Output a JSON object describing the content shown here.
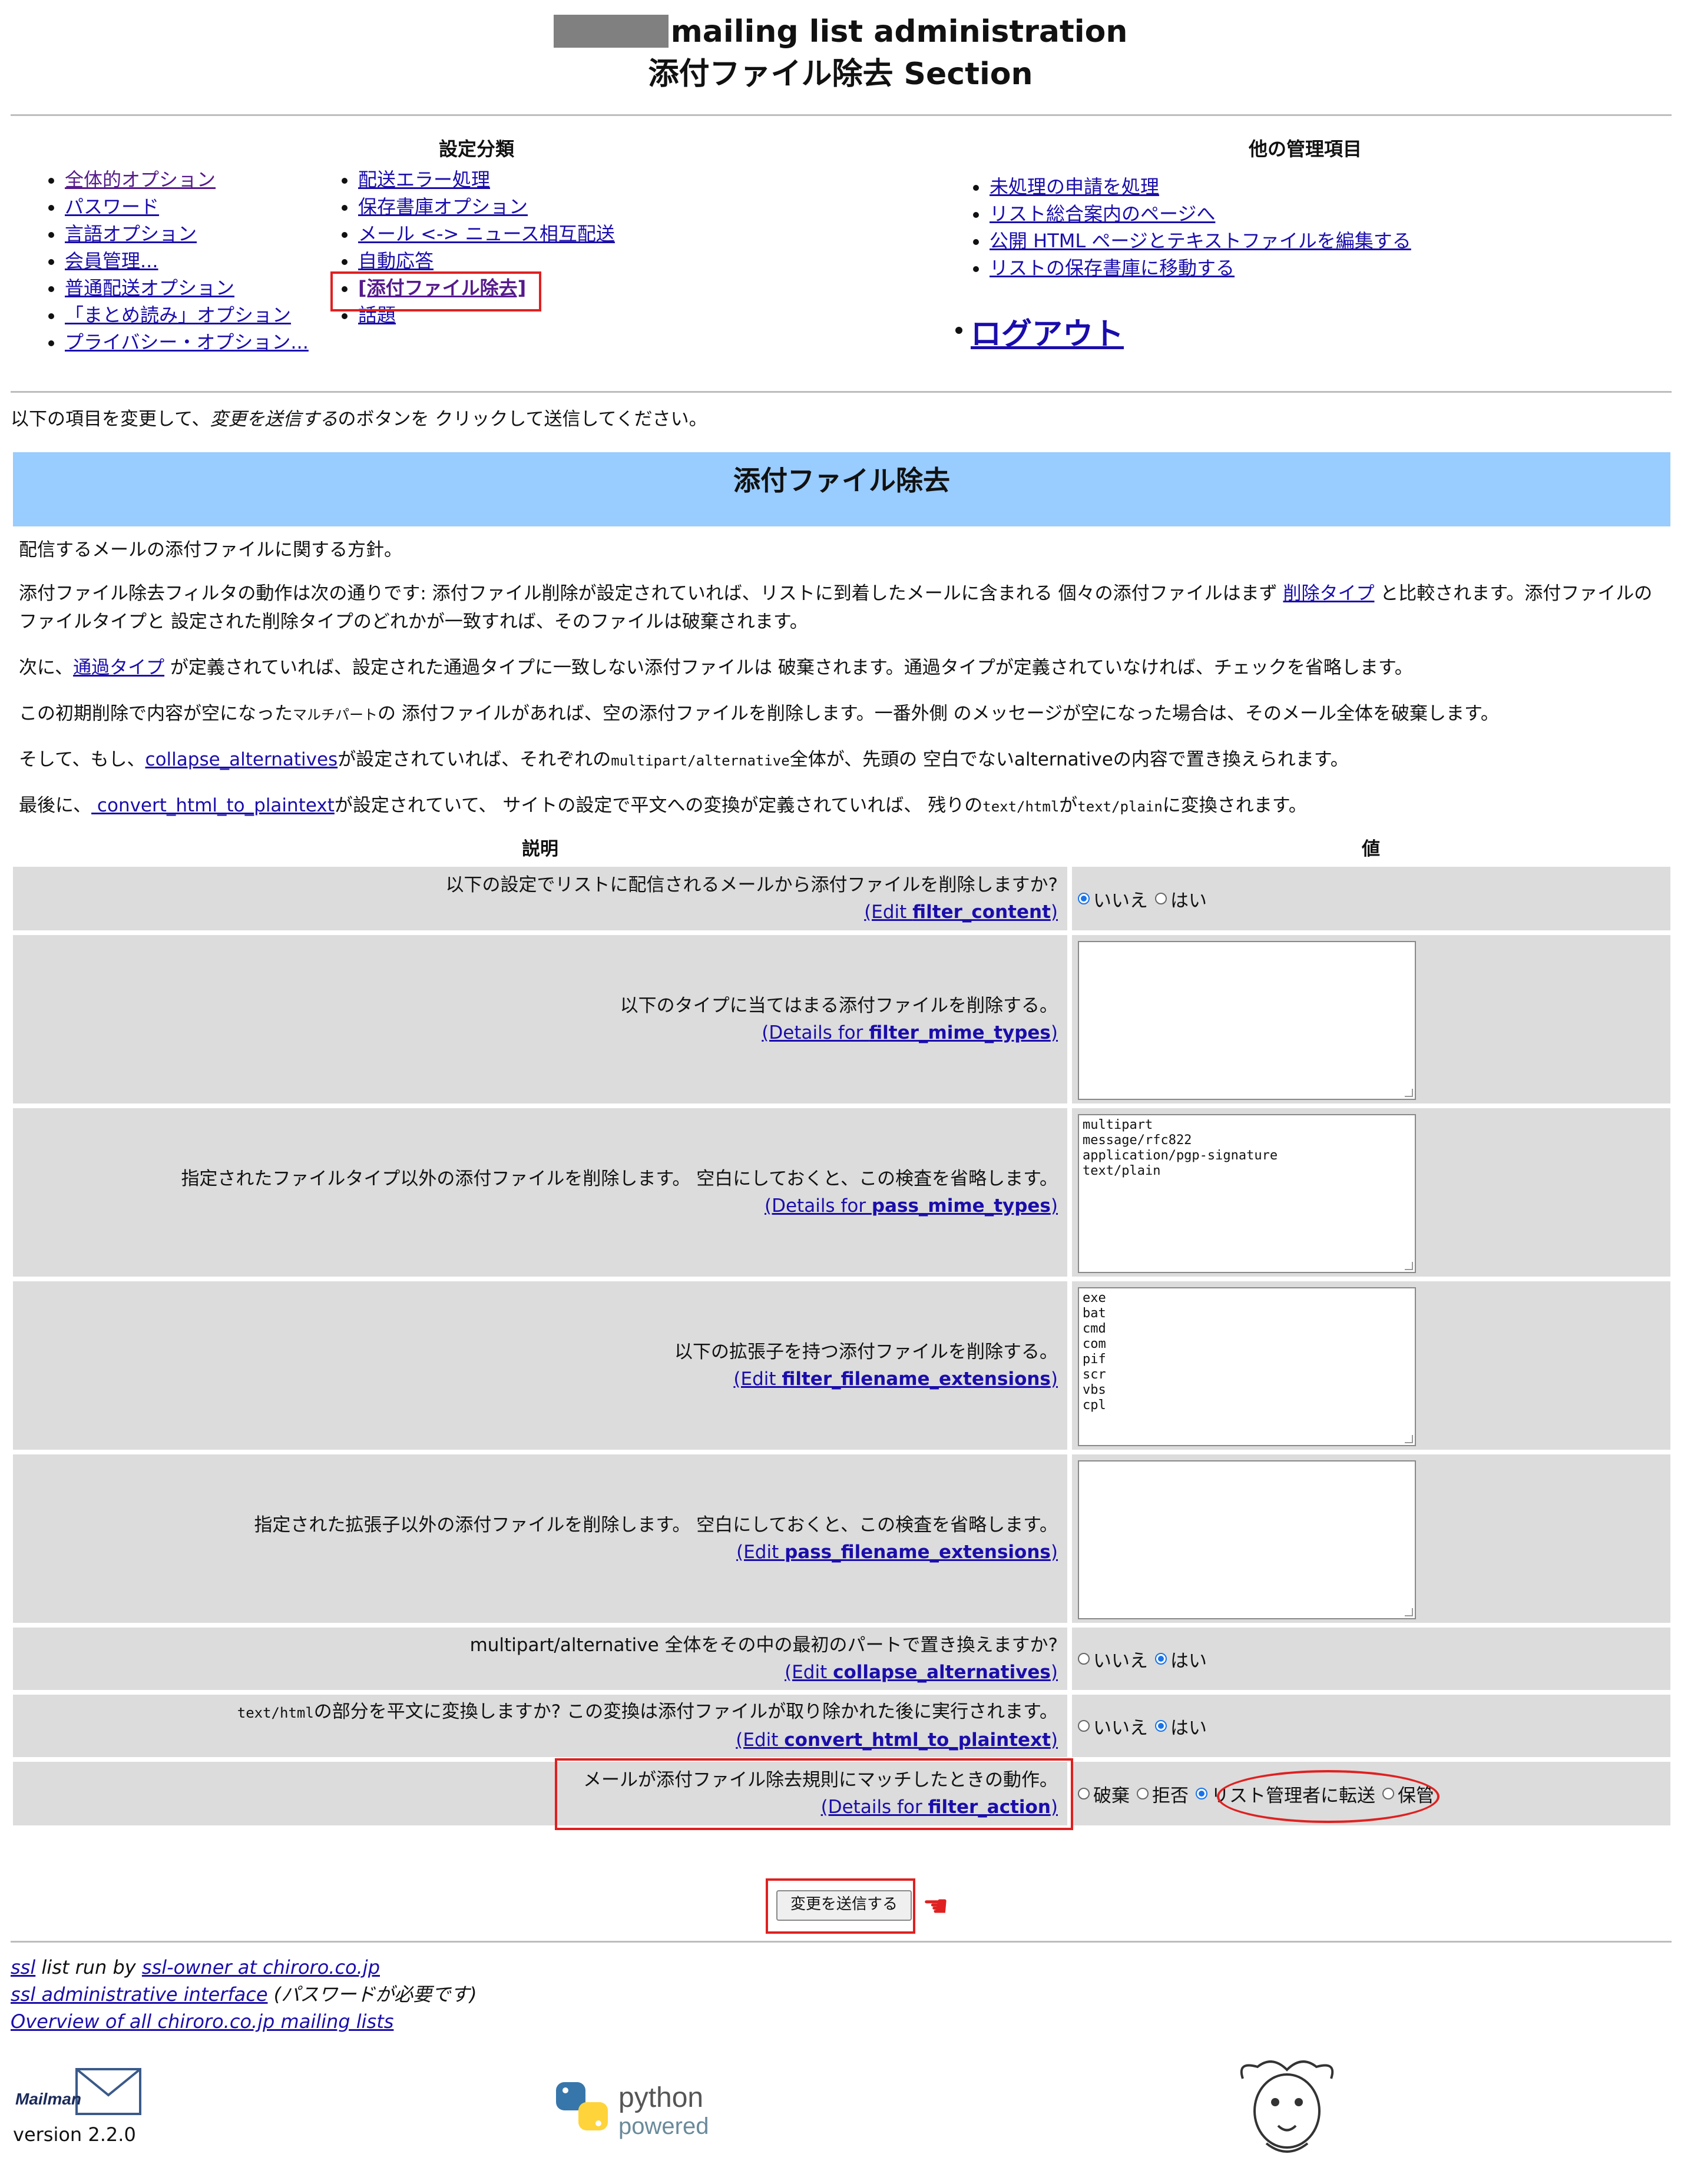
{
  "header": {
    "title_line1": "mailing list administration",
    "title_line2": "添付ファイル除去 Section"
  },
  "nav": {
    "categories_heading": "設定分類",
    "col1": [
      "全体的オプション",
      "パスワード",
      "言語オプション",
      "会員管理...",
      "普通配送オプション",
      "「まとめ読み」オプション",
      "プライバシー・オプション..."
    ],
    "col2": [
      "配送エラー処理",
      "保存書庫オプション",
      "メール <-> ニュース相互配送",
      "自動応答",
      "[添付ファイル除去]",
      "話題"
    ],
    "other_heading": "他の管理項目",
    "other": [
      "未処理の申請を処理",
      "リスト総合案内のページへ",
      "公開 HTML ページとテキストファイルを編集する",
      "リストの保存書庫に移動する"
    ],
    "logout": "ログアウト"
  },
  "intro": {
    "before": "以下の項目を変更して、",
    "emphasis": "変更を送信する",
    "after": "のボタンを クリックして送信してください。"
  },
  "section_title": "添付ファイル除去",
  "descriptions": {
    "p1": "配信するメールの添付ファイルに関する方針。",
    "p2_a": "添付ファイル除去フィルタの動作は次の通りです: 添付ファイル削除が設定されていれば、リストに到着したメールに含まれる 個々の添付ファイルはまず ",
    "p2_link": "削除タイプ",
    "p2_b": " と比較されます。添付ファイルのファイルタイプと 設定された削除タイプのどれかが一致すれば、そのファイルは破棄されます。",
    "p3_a": "次に、",
    "p3_link": "通過タイプ",
    "p3_b": " が定義されていれば、設定された通過タイプに一致しない添付ファイルは 破棄されます。通過タイプが定義されていなければ、チェックを省略します。",
    "p4_a": "この初期削除で内容が空になった",
    "p4_small": "マルチパート",
    "p4_b": "の 添付ファイルがあれば、空の添付ファイルを削除します。一番外側 のメッセージが空になった場合は、そのメール全体を破棄します。",
    "p5_a": "そして、もし、",
    "p5_link": "collapse_alternatives",
    "p5_b": "が設定されていれば、それぞれの",
    "p5_code": "multipart/alternative",
    "p5_c": "全体が、先頭の 空白でないalternativeの内容で置き換えられます。",
    "p6_a": "最後に、",
    "p6_link": " convert_html_to_plaintext",
    "p6_b": "が設定されていて、 サイトの設定で平文への変換が定義されていれば、 残りの",
    "p6_code1": "text/html",
    "p6_c": "が",
    "p6_code2": "text/plain",
    "p6_d": "に変換されます。"
  },
  "table": {
    "col_desc": "説明",
    "col_value": "値",
    "rows": [
      {
        "label": "以下の設定でリストに配信されるメールから添付ファイルを削除しますか?",
        "link_prefix": "(Edit ",
        "link_name": "filter_content",
        "link_suffix": ")"
      },
      {
        "label": "以下のタイプに当てはまる添付ファイルを削除する。",
        "link_prefix": "(Details for ",
        "link_name": "filter_mime_types",
        "link_suffix": ")",
        "textarea": ""
      },
      {
        "label": "指定されたファイルタイプ以外の添付ファイルを削除します。 空白にしておくと、この検査を省略します。",
        "link_prefix": "(Details for ",
        "link_name": "pass_mime_types",
        "link_suffix": ")",
        "textarea": "multipart\nmessage/rfc822\napplication/pgp-signature\ntext/plain"
      },
      {
        "label": "以下の拡張子を持つ添付ファイルを削除する。",
        "link_prefix": "(Edit ",
        "link_name": "filter_filename_extensions",
        "link_suffix": ")",
        "textarea": "exe\nbat\ncmd\ncom\npif\nscr\nvbs\ncpl"
      },
      {
        "label": "指定された拡張子以外の添付ファイルを削除します。 空白にしておくと、この検査を省略します。",
        "link_prefix": "(Edit ",
        "link_name": "pass_filename_extensions",
        "link_suffix": ")",
        "textarea": ""
      },
      {
        "label": "multipart/alternative 全体をその中の最初のパートで置き換えますか?",
        "link_prefix": "(Edit ",
        "link_name": "collapse_alternatives",
        "link_suffix": ")"
      },
      {
        "label_code": "text/html",
        "label": "の部分を平文に変換しますか? この変換は添付ファイルが取り除かれた後に実行されます。",
        "link_prefix": "(Edit ",
        "link_name": "convert_html_to_plaintext",
        "link_suffix": ")"
      },
      {
        "label": "メールが添付ファイル除去規則にマッチしたときの動作。",
        "link_prefix": "(Details for ",
        "link_name": "filter_action",
        "link_suffix": ")"
      }
    ],
    "radios": {
      "filter_content": {
        "options": [
          "いいえ",
          "はい"
        ],
        "selected": "いいえ"
      },
      "collapse_alternatives": {
        "options": [
          "いいえ",
          "はい"
        ],
        "selected": "はい"
      },
      "convert_html_to_plaintext": {
        "options": [
          "いいえ",
          "はい"
        ],
        "selected": "はい"
      },
      "filter_action": {
        "options": [
          "破棄",
          "拒否",
          "リスト管理者に転送",
          "保管"
        ],
        "selected": "リスト管理者に転送"
      }
    }
  },
  "submit_label": "変更を送信する",
  "footer": {
    "list_name": "ssl",
    "run_by": " list run by ",
    "owner": "ssl-owner at chiroro.co.jp",
    "admin_link": "ssl administrative interface",
    "admin_note": " (パスワードが必要です)",
    "overview": "Overview of all chiroro.co.jp mailing lists",
    "version": "version 2.2.0"
  },
  "logos": {
    "mailman": "Mailman",
    "python_word": "python",
    "python_sub": "powered"
  },
  "colors": {
    "section_bg": "#99ccff",
    "row_bg": "#dcdcdc",
    "highlight": "#e02020",
    "link": "#1a0dab"
  }
}
